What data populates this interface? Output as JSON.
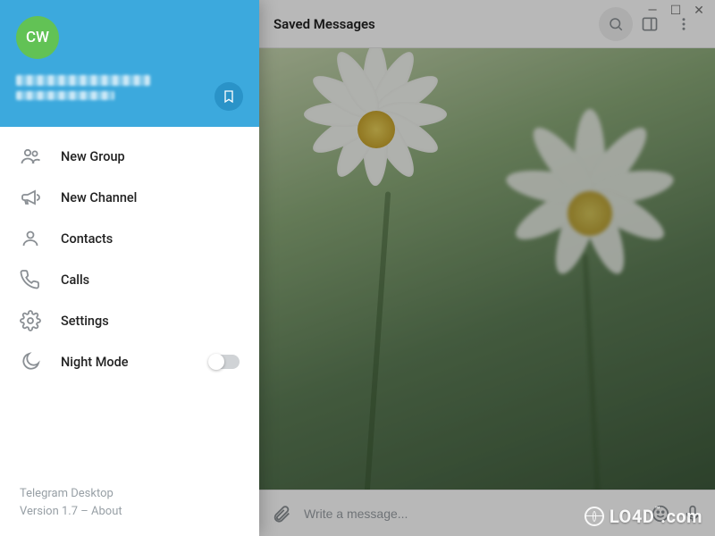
{
  "window": {
    "controls": {
      "min": "—",
      "max": "☐",
      "close": "✕"
    }
  },
  "header": {
    "title": "Saved Messages"
  },
  "profile": {
    "avatar_initials": "CW"
  },
  "menu": {
    "items": [
      {
        "key": "new-group",
        "label": "New Group",
        "icon": "group-icon"
      },
      {
        "key": "new-channel",
        "label": "New Channel",
        "icon": "megaphone-icon"
      },
      {
        "key": "contacts",
        "label": "Contacts",
        "icon": "person-icon"
      },
      {
        "key": "calls",
        "label": "Calls",
        "icon": "phone-icon"
      },
      {
        "key": "settings",
        "label": "Settings",
        "icon": "gear-icon"
      },
      {
        "key": "night-mode",
        "label": "Night Mode",
        "icon": "moon-icon",
        "toggle": false
      }
    ]
  },
  "footer": {
    "app_name": "Telegram Desktop",
    "version_line": "Version 1.7 – About"
  },
  "compose": {
    "placeholder": "Write a message..."
  },
  "watermark": {
    "text": "LO4D",
    "suffix": ".com"
  },
  "colors": {
    "accent": "#3ca9dd",
    "avatar": "#62c255"
  }
}
